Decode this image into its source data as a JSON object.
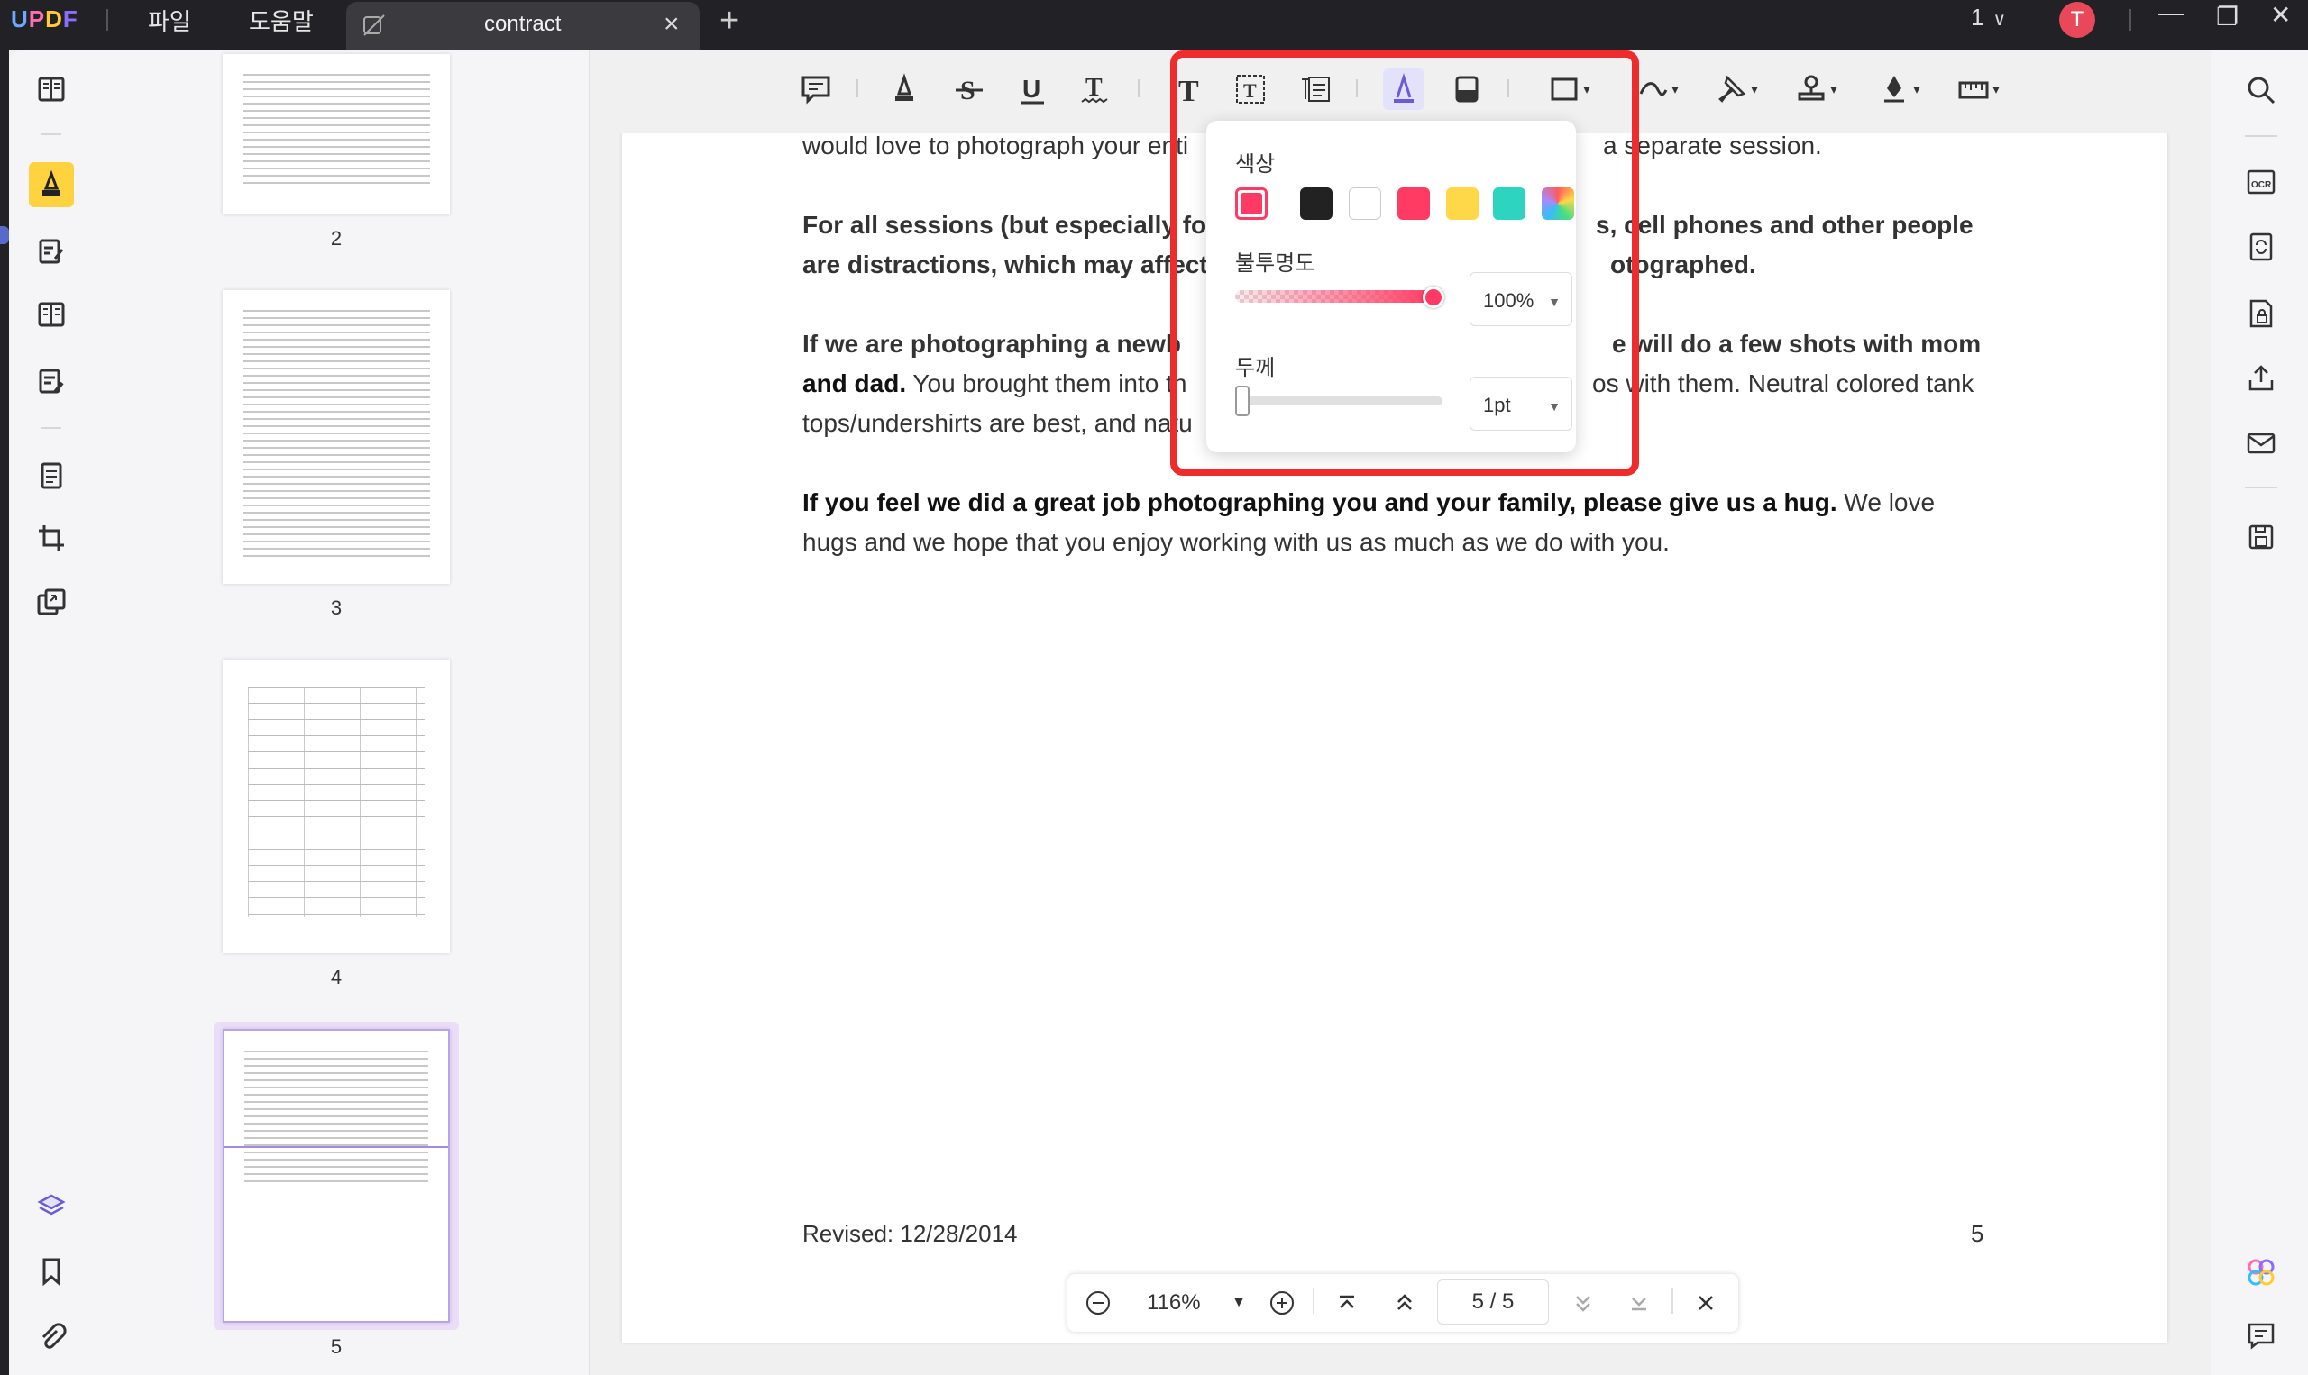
{
  "titlebar": {
    "app_logo": "UPDF",
    "menu": [
      "파일",
      "도움말"
    ],
    "tab_name": "contract",
    "page_selector": "1",
    "avatar_initial": "T"
  },
  "thumbnails": {
    "pages": [
      "2",
      "3",
      "4",
      "5"
    ],
    "selected": "5"
  },
  "document": {
    "paragraphs": [
      {
        "bold": "",
        "text_a": "would love to photograph your ",
        "hidden_middle": true,
        "text_b": "a separate session."
      },
      {
        "bold": "For all sessions (but especially fo",
        "text_b": "s, cell phones and other people are distractions, which may affect",
        "tail": "otographed."
      },
      {
        "bold": "If we are photographing a newb",
        "mid": "e will do a few shots with mom and dad.",
        "text": " You brought them into th",
        "text_b": "os with them. Neutral colored tank tops/undershirts are best, and natu"
      },
      {
        "bold": "If you feel we did a great job photographing you and your family, please give us a hug.",
        "text": " We love hugs and we hope that you enjoy working with us as much as we do with you."
      }
    ],
    "line1_left": "would love to photograph your ",
    "line1_frag": "enti",
    "line1_right": "a separate session.",
    "p2_line1_left": "For all sessions (but especially fo",
    "p2_line1_right": "s, cell phones and other people",
    "p2_line2_left": "are distractions, which may af",
    "p2_line2_frag": "fect",
    "p2_line2_right": "otographed.",
    "p3_line1_left": "If we are photographing a newb",
    "p3_line1_right": "e will do a few shots with mom",
    "p3_line2_bold": "and dad.",
    "p3_line2_left": " You brought them into th",
    "p3_line2_right": "os with them. Neutral colored tank",
    "p3_line3_left": "tops/undershirts are best, and natu",
    "p4_bold": "If you feel we did a great job photographing you and your family, please give us a hug.",
    "p4_text": " We love hugs and we hope that you enjoy working with us as much as we do with you.",
    "footer_revised": "Revised: 12/28/2014",
    "footer_page": "5"
  },
  "popover": {
    "color_label": "색상",
    "colors": [
      "#ff3b63",
      "#222222",
      "#ffffff",
      "#ff3b63",
      "#ffd84a",
      "#2dd4bf",
      "rainbow"
    ],
    "selected_color": "#ff3b63",
    "opacity_label": "불투명도",
    "opacity_value": "100%",
    "opacity_fraction": 1.0,
    "thickness_label": "두께",
    "thickness_value": "1pt",
    "thickness_fraction": 0.0
  },
  "navbar": {
    "zoom": "116%",
    "page_current": "5",
    "page_sep": "/",
    "page_total": "5"
  },
  "accent": {
    "highlight": "#ffd23f",
    "annotation_red": "#ef2b2b",
    "brand_purple": "#8b6dff"
  }
}
